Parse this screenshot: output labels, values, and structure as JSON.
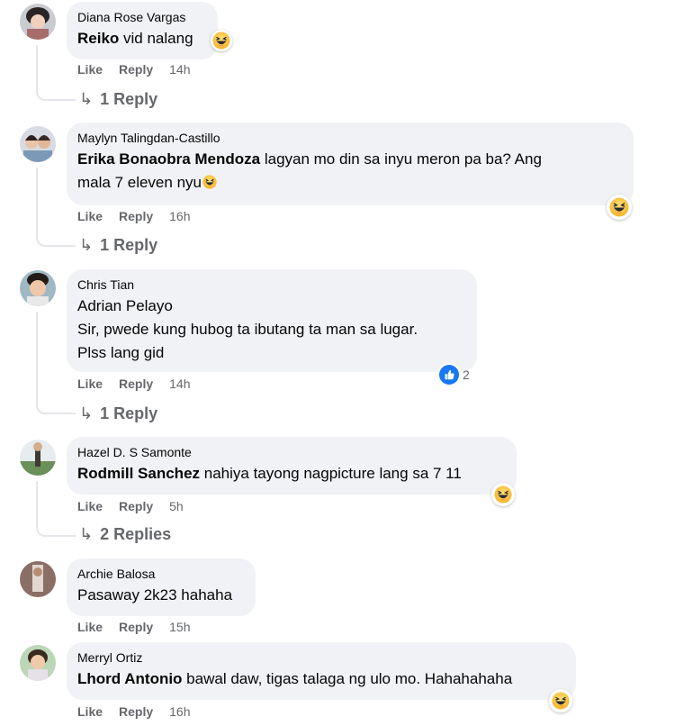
{
  "comments": [
    {
      "author": "Diana Rose Vargas",
      "mention": "Reiko",
      "text": " vid nalang",
      "actions": {
        "like": "Like",
        "reply": "Reply",
        "time": "14h"
      },
      "replies": "1 Reply",
      "reaction": "haha-icon"
    },
    {
      "author": "Maylyn Talingdan-Castillo",
      "mention": "Erika Bonaobra Mendoza",
      "text_line1": " lagyan mo din sa inyu meron pa ba? Ang",
      "text_line2": "mala 7 eleven nyu",
      "actions": {
        "like": "Like",
        "reply": "Reply",
        "time": "16h"
      },
      "replies": "1 Reply",
      "reaction": "haha-icon"
    },
    {
      "author": "Chris Tian",
      "line1": "Adrian Pelayo",
      "line2": "Sir, pwede kung hubog ta ibutang ta man sa lugar.",
      "line3": "Plss lang gid",
      "actions": {
        "like": "Like",
        "reply": "Reply",
        "time": "14h"
      },
      "replies": "1 Reply",
      "reaction": "like-icon",
      "reaction_count": "2"
    },
    {
      "author": "Hazel D. S Samonte",
      "mention": "Rodmill Sanchez",
      "text": " nahiya tayong nagpicture lang sa 7 11",
      "actions": {
        "like": "Like",
        "reply": "Reply",
        "time": "5h"
      },
      "replies": "2 Replies",
      "reaction": "haha-icon"
    },
    {
      "author": "Archie Balosa",
      "text": "Pasaway 2k23 hahaha",
      "actions": {
        "like": "Like",
        "reply": "Reply",
        "time": "15h"
      }
    },
    {
      "author": "Merryl Ortiz",
      "mention": "Lhord Antonio",
      "text": " bawal daw, tigas talaga ng ulo mo. Hahahahaha",
      "actions": {
        "like": "Like",
        "reply": "Reply",
        "time": "16h"
      },
      "reaction": "haha-icon"
    }
  ],
  "colors": {
    "bubble": "#f0f2f5",
    "meta": "#65676b",
    "like_blue": "#1877f2",
    "haha_yellow": "#f7b125"
  }
}
